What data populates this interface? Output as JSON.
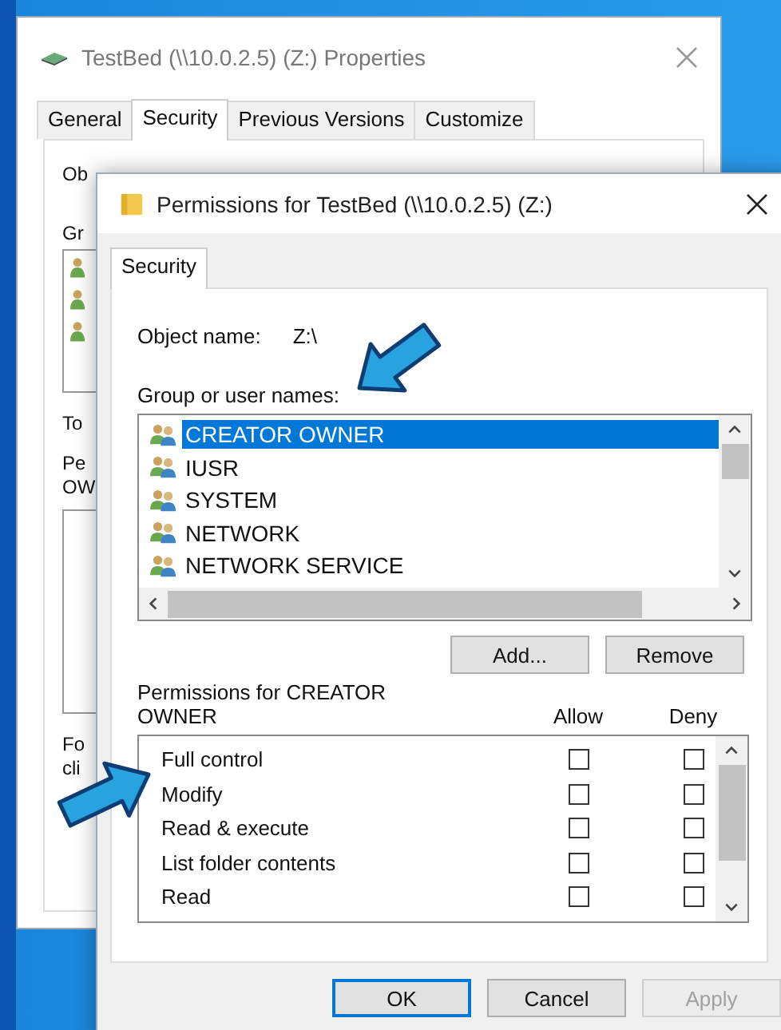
{
  "back_window": {
    "title": "TestBed (\\\\10.0.2.5) (Z:) Properties",
    "tabs": [
      {
        "label": "General",
        "selected": false
      },
      {
        "label": "Security",
        "selected": true
      },
      {
        "label": "Previous Versions",
        "selected": false
      },
      {
        "label": "Customize",
        "selected": false
      }
    ],
    "cut_labels": [
      "Ob",
      "Gr",
      "To",
      "Pe",
      "OW",
      "Fo",
      "cli"
    ]
  },
  "dialog": {
    "title": "Permissions for TestBed (\\\\10.0.2.5) (Z:)",
    "tabs": [
      {
        "label": "Security",
        "selected": true
      }
    ],
    "object_name_label": "Object name:",
    "object_name": "Z:\\",
    "groups_label": "Group or user names:",
    "groups": [
      {
        "name": "CREATOR OWNER",
        "selected": true
      },
      {
        "name": "IUSR",
        "selected": false
      },
      {
        "name": "SYSTEM",
        "selected": false
      },
      {
        "name": "NETWORK",
        "selected": false
      },
      {
        "name": "NETWORK SERVICE",
        "selected": false
      }
    ],
    "group_buttons": [
      {
        "label": "Add...",
        "disabled": false
      },
      {
        "label": "Remove",
        "disabled": false
      }
    ],
    "permissions_label": "Permissions for CREATOR OWNER",
    "columns": [
      "Allow",
      "Deny"
    ],
    "permissions": [
      {
        "name": "Full control",
        "allow": false,
        "deny": false
      },
      {
        "name": "Modify",
        "allow": false,
        "deny": false
      },
      {
        "name": "Read & execute",
        "allow": false,
        "deny": false
      },
      {
        "name": "List folder contents",
        "allow": false,
        "deny": false
      },
      {
        "name": "Read",
        "allow": false,
        "deny": false
      }
    ],
    "buttons": [
      {
        "label": "OK",
        "default": true,
        "disabled": false
      },
      {
        "label": "Cancel",
        "default": false,
        "disabled": false
      },
      {
        "label": "Apply",
        "default": false,
        "disabled": true
      }
    ]
  }
}
